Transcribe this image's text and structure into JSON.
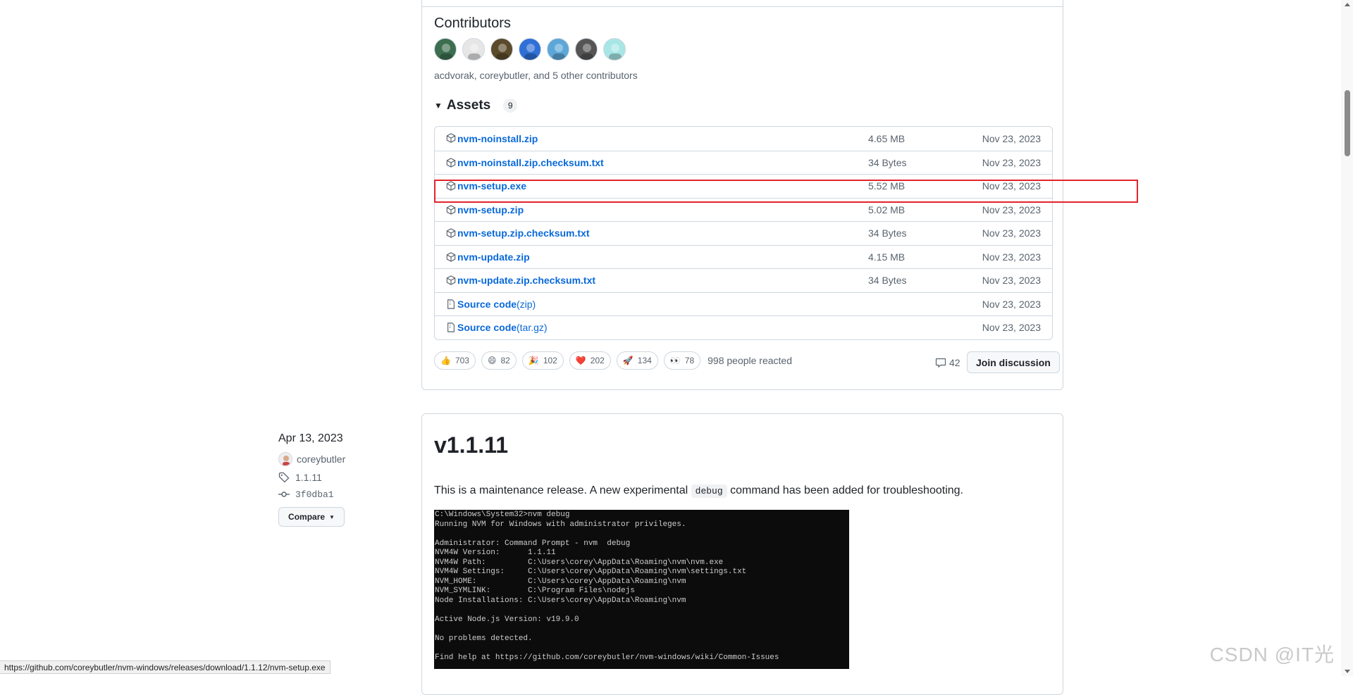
{
  "contributors": {
    "heading": "Contributors",
    "text": "acdvorak, coreybutler, and 5 other contributors",
    "avatar_colors": [
      "#3c6e4f",
      "#e6e6e6",
      "#5b4a2b",
      "#2f6fd6",
      "#5ca6d8",
      "#555555",
      "#a8e6e6"
    ]
  },
  "assets": {
    "heading": "Assets",
    "count": "9",
    "items": [
      {
        "name": "nvm-noinstall.zip",
        "suffix": "",
        "size": "4.65 MB",
        "date": "Nov 23, 2023",
        "icon": "package-icon"
      },
      {
        "name": "nvm-noinstall.zip.checksum.txt",
        "suffix": "",
        "size": "34 Bytes",
        "date": "Nov 23, 2023",
        "icon": "package-icon"
      },
      {
        "name": "nvm-setup.exe",
        "suffix": "",
        "size": "5.52 MB",
        "date": "Nov 23, 2023",
        "icon": "package-icon"
      },
      {
        "name": "nvm-setup.zip",
        "suffix": "",
        "size": "5.02 MB",
        "date": "Nov 23, 2023",
        "icon": "package-icon"
      },
      {
        "name": "nvm-setup.zip.checksum.txt",
        "suffix": "",
        "size": "34 Bytes",
        "date": "Nov 23, 2023",
        "icon": "package-icon"
      },
      {
        "name": "nvm-update.zip",
        "suffix": "",
        "size": "4.15 MB",
        "date": "Nov 23, 2023",
        "icon": "package-icon"
      },
      {
        "name": "nvm-update.zip.checksum.txt",
        "suffix": "",
        "size": "34 Bytes",
        "date": "Nov 23, 2023",
        "icon": "package-icon"
      },
      {
        "name": "Source code",
        "suffix": " (zip)",
        "size": "",
        "date": "Nov 23, 2023",
        "icon": "file-zip-icon"
      },
      {
        "name": "Source code",
        "suffix": " (tar.gz)",
        "size": "",
        "date": "Nov 23, 2023",
        "icon": "file-zip-icon"
      }
    ]
  },
  "reactions": {
    "items": [
      {
        "emoji": "👍",
        "count": "703"
      },
      {
        "emoji": "😄",
        "count": "82"
      },
      {
        "emoji": "🎉",
        "count": "102"
      },
      {
        "emoji": "❤️",
        "count": "202"
      },
      {
        "emoji": "🚀",
        "count": "134"
      },
      {
        "emoji": "👀",
        "count": "78"
      }
    ],
    "summary": "998 people reacted",
    "comments": "42",
    "join_label": "Join discussion"
  },
  "release_meta": {
    "date": "Apr 13, 2023",
    "author": "coreybutler",
    "tag": "1.1.11",
    "commit": "3f0dba1",
    "compare_label": "Compare"
  },
  "release": {
    "title": "v1.1.11",
    "desc_before": "This is a maintenance release. A new experimental ",
    "desc_code": "debug",
    "desc_after": " command has been added for troubleshooting.",
    "terminal": "C:\\Windows\\System32>nvm debug\nRunning NVM for Windows with administrator privileges.\n\nAdministrator: Command Prompt - nvm  debug\nNVM4W Version:      1.1.11\nNVM4W Path:         C:\\Users\\corey\\AppData\\Roaming\\nvm\\nvm.exe\nNVM4W Settings:     C:\\Users\\corey\\AppData\\Roaming\\nvm\\settings.txt\nNVM_HOME:           C:\\Users\\corey\\AppData\\Roaming\\nvm\nNVM_SYMLINK:        C:\\Program Files\\nodejs\nNode Installations: C:\\Users\\corey\\AppData\\Roaming\\nvm\n\nActive Node.js Version: v19.9.0\n\nNo problems detected.\n\nFind help at https://github.com/coreybutler/nvm-windows/wiki/Common-Issues"
  },
  "status_url": "https://github.com/coreybutler/nvm-windows/releases/download/1.1.12/nvm-setup.exe",
  "watermark": "CSDN @IT光"
}
